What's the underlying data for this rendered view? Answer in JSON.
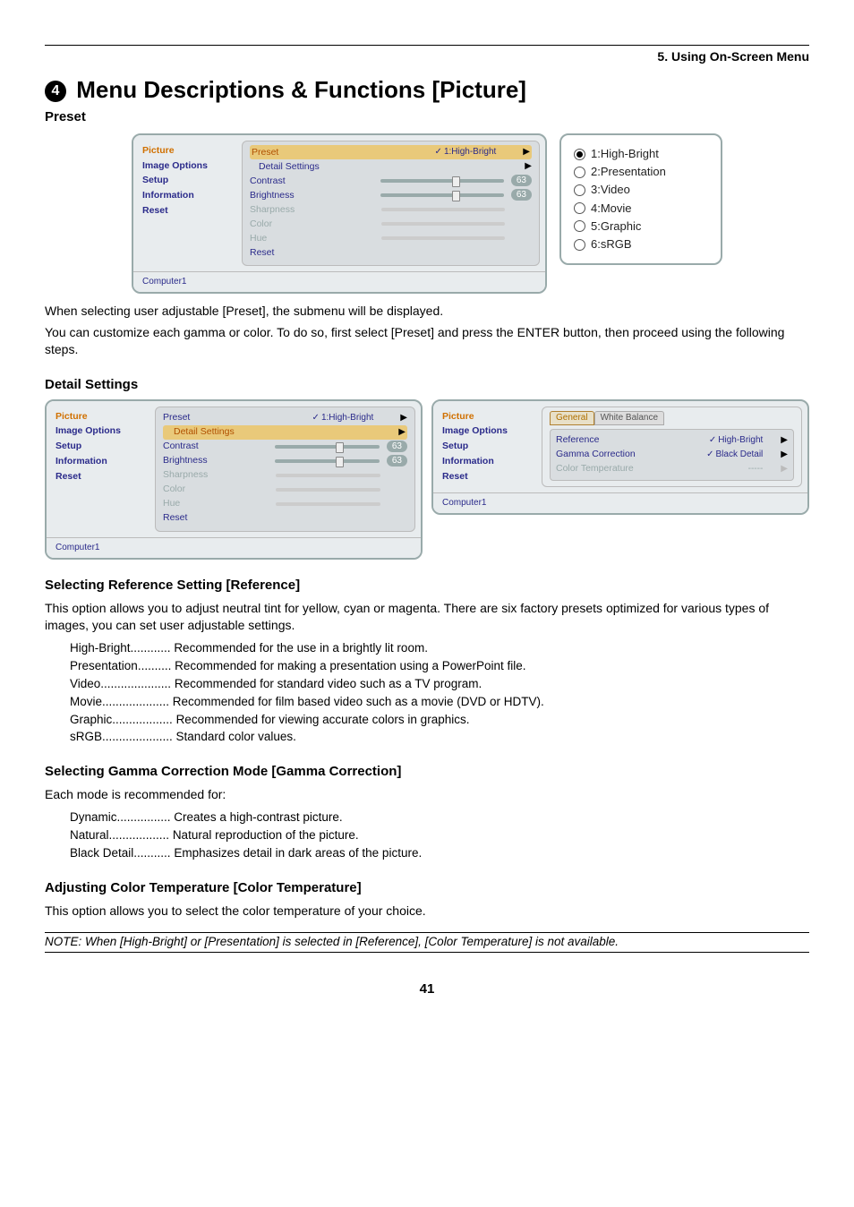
{
  "chapter": "5. Using On-Screen Menu",
  "title_number": "4",
  "title": "Menu Descriptions & Functions [Picture]",
  "subtitle_preset": "Preset",
  "osd_side": [
    "Picture",
    "Image Options",
    "Setup",
    "Information",
    "Reset"
  ],
  "osd_status": "Computer1",
  "osd_picture": {
    "preset": {
      "label": "Preset",
      "value": "1:High-Bright"
    },
    "detail": "Detail Settings",
    "contrast": {
      "label": "Contrast",
      "value": "63"
    },
    "brightness": {
      "label": "Brightness",
      "value": "63"
    },
    "sharpness": "Sharpness",
    "colorlab": "Color",
    "hue": "Hue",
    "reset": "Reset"
  },
  "preset_popup": [
    "1:High-Bright",
    "2:Presentation",
    "3:Video",
    "4:Movie",
    "5:Graphic",
    "6:sRGB"
  ],
  "intro_p1": "When selecting user adjustable [Preset], the submenu will be displayed.",
  "intro_p2": "You can customize each gamma or color. To do so, first select [Preset] and press the ENTER button, then proceed using the following steps.",
  "h_detail": "Detail Settings",
  "detail_tabs": {
    "general": "General",
    "wb": "White Balance"
  },
  "detail_rows": {
    "reference": {
      "label": "Reference",
      "value": "High-Bright"
    },
    "gamma": {
      "label": "Gamma Correction",
      "value": "Black Detail"
    },
    "colortemp": {
      "label": "Color Temperature",
      "value": "-----"
    }
  },
  "h_ref": "Selecting Reference Setting [Reference]",
  "ref_p": "This option allows you to adjust neutral tint for yellow, cyan or magenta. There are six factory presets optimized for various types of images, you can set user adjustable settings.",
  "ref_list": [
    {
      "term": "High-Bright",
      "dots": "............",
      "desc": "Recommended for the use in a brightly lit room."
    },
    {
      "term": "Presentation",
      "dots": " ..........",
      "desc": "Recommended for making a presentation using a PowerPoint file."
    },
    {
      "term": "Video",
      "dots": " .....................",
      "desc": "Recommended for standard video such as a TV program."
    },
    {
      "term": "Movie",
      "dots": " ....................",
      "desc": "Recommended for film based video such as a movie (DVD or HDTV)."
    },
    {
      "term": "Graphic",
      "dots": "..................",
      "desc": "Recommended for viewing accurate colors in graphics."
    },
    {
      "term": "sRGB",
      "dots": " .....................",
      "desc": "Standard color values."
    }
  ],
  "h_gamma": "Selecting Gamma Correction Mode [Gamma Correction]",
  "gamma_p": "Each mode is recommended for:",
  "gamma_list": [
    {
      "term": "Dynamic",
      "dots": " ................",
      "desc": "Creates a high-contrast picture."
    },
    {
      "term": "Natural",
      "dots": " ..................",
      "desc": "Natural reproduction of the picture."
    },
    {
      "term": "Black Detail",
      "dots": " ...........",
      "desc": "Emphasizes detail in dark areas of the picture."
    }
  ],
  "h_ct": "Adjusting Color Temperature [Color Temperature]",
  "ct_p": "This option allows you to select the color temperature of your choice.",
  "note": "NOTE: When [High-Bright] or [Presentation] is selected in [Reference], [Color Temperature] is not available.",
  "page_number": "41"
}
